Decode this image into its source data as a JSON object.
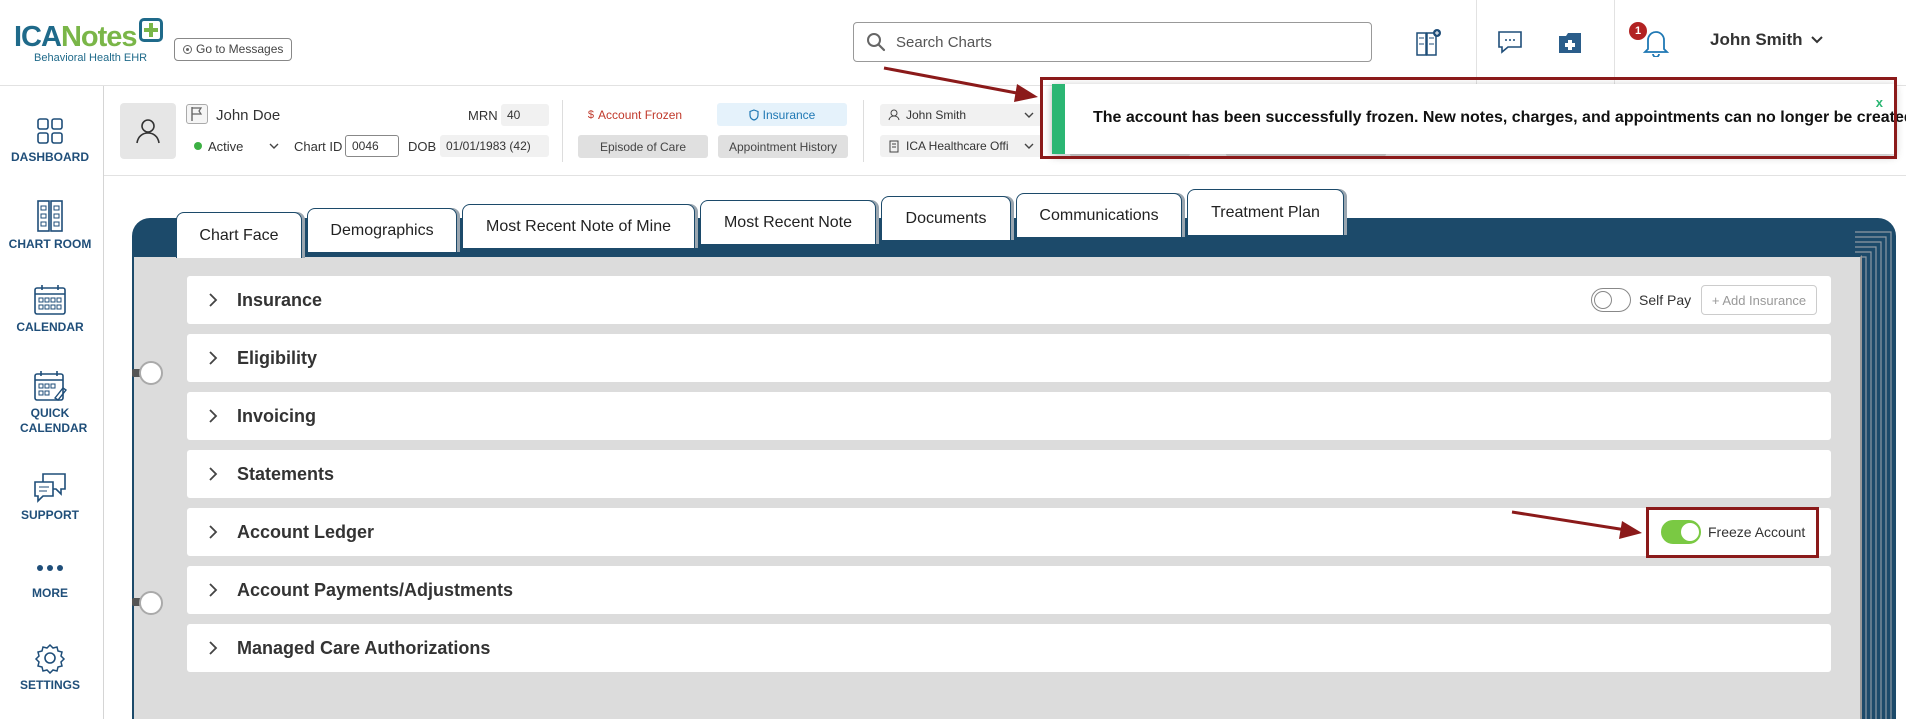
{
  "header": {
    "logo_main_ica": "ICA",
    "logo_main_notes": "Notes",
    "logo_sub": "Behavioral Health EHR",
    "goto_messages": "Go to Messages",
    "search_placeholder": "Search Charts",
    "notification_count": "1",
    "user_name": "John Smith"
  },
  "sidebar": {
    "items": [
      {
        "label": "DASHBOARD",
        "icon": "dashboard-icon"
      },
      {
        "label": "CHART ROOM",
        "icon": "chart-room-icon"
      },
      {
        "label": "CALENDAR",
        "icon": "calendar-icon"
      },
      {
        "label": "QUICK CALENDAR",
        "icon": "quick-calendar-icon"
      },
      {
        "label": "SUPPORT",
        "icon": "support-icon"
      },
      {
        "label": "MORE",
        "icon": "more-icon"
      },
      {
        "label": "SETTINGS",
        "icon": "settings-icon"
      }
    ]
  },
  "patient": {
    "name": "John Doe",
    "status": "Active",
    "mrn_label": "MRN",
    "mrn": "40",
    "chart_id_label": "Chart ID",
    "chart_id": "0046",
    "dob_label": "DOB",
    "dob": "01/01/1983 (42)",
    "account_frozen": "Account Frozen",
    "insurance": "Insurance",
    "episode_of_care": "Episode of Care",
    "appointment_history": "Appointment History",
    "provider": "John Smith",
    "facility": "ICA Healthcare Offi"
  },
  "toast": {
    "message": "The account has been successfully frozen. New notes, charges, and appointments can no longer be created.",
    "close": "x"
  },
  "tabs": [
    {
      "label": "Chart Face"
    },
    {
      "label": "Demographics"
    },
    {
      "label": "Most Recent Note of Mine"
    },
    {
      "label": "Most Recent Note"
    },
    {
      "label": "Documents"
    },
    {
      "label": "Communications"
    },
    {
      "label": "Treatment Plan"
    }
  ],
  "sections": [
    {
      "title": "Insurance"
    },
    {
      "title": "Eligibility"
    },
    {
      "title": "Invoicing"
    },
    {
      "title": "Statements"
    },
    {
      "title": "Account Ledger"
    },
    {
      "title": "Account Payments/Adjustments"
    },
    {
      "title": "Managed Care Authorizations"
    }
  ],
  "insurance_controls": {
    "self_pay_label": "Self Pay",
    "self_pay_on": false,
    "add_insurance": "+ Add Insurance"
  },
  "ledger_controls": {
    "freeze_label": "Freeze Account",
    "freeze_on": true
  },
  "colors": {
    "brand_blue": "#1f6a8a",
    "brand_green": "#7ab648",
    "nav_text": "#1f4e79",
    "toast_accent": "#2bb673",
    "annotation_red": "#8b1a1a",
    "binder": "#1c4a6a"
  }
}
